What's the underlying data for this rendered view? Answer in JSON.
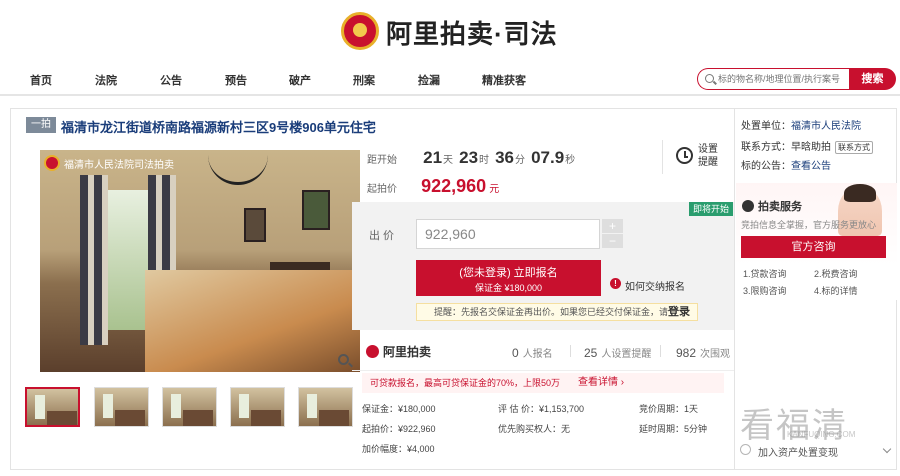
{
  "brand": {
    "name": "阿里拍卖·司法"
  },
  "nav": {
    "items": [
      {
        "label": "首页"
      },
      {
        "label": "法院"
      },
      {
        "label": "公告"
      },
      {
        "label": "预告"
      },
      {
        "label": "破产"
      },
      {
        "label": "刑案"
      },
      {
        "label": "捡漏"
      },
      {
        "label": "精准获客"
      }
    ],
    "search_placeholder": "标的物名称/地理位置/执行案号",
    "search_button": "搜索"
  },
  "lot": {
    "tag": "一拍",
    "title": "福清市龙江街道桥南路福源新村三区9号楼906单元住宅",
    "photo_watermark": "福清市人民法院司法拍卖",
    "countdown": {
      "label": "距开始",
      "days": "21",
      "days_unit": "天",
      "hours": "23",
      "hours_unit": "时",
      "minutes": "36",
      "minutes_unit": "分",
      "seconds": "07.9",
      "seconds_unit": "秒"
    },
    "reminder_label": "设置提醒",
    "start_price_label": "起拍价",
    "start_price": "922,960",
    "currency": "元",
    "status_badge": "即将开始",
    "bid_label": "出 价",
    "bid_value": "922,960",
    "step_plus": "+",
    "step_minus": "−",
    "register_line1": "(您未登录) 立即报名",
    "register_line2": "保证金 ¥180,000",
    "how_pay_link": "如何交纳报名",
    "notice_text": "提醒：先报名交保证金再出价。如果您已经交付保证金，请",
    "notice_login": "登录",
    "platform_name": "阿里拍卖",
    "stats": {
      "signup_count": "0",
      "signup_label": "人报名",
      "reminder_count": "25",
      "reminder_label": "人设置提醒",
      "view_count": "982",
      "view_label": "次围观"
    },
    "loan_notice": "可贷款报名，最高可贷保证金的70%，上限50万",
    "loan_link": "查看详情 ›",
    "info": {
      "deposit": "保证金：¥180,000",
      "appraisal": "评 估 价：¥1,153,700",
      "bid_period": "竞价周期：1天",
      "start_price": "起拍价：¥922,960",
      "priority_buyer": "优先购买权人：无",
      "delay_period": "延时周期：5分钟",
      "increment": "加价幅度：¥4,000"
    }
  },
  "side": {
    "unit_label": "处置单位：",
    "unit_value": "福清市人民法院",
    "contact_label": "联系方式：",
    "contact_value": "早晗助拍",
    "contact_tag": "联系方式",
    "notice_label": "标的公告：",
    "notice_link": "查看公告",
    "service_title": "拍卖服务",
    "service_sub": "竞拍信息全掌握，官方服务更放心",
    "service_button": "官方咨询",
    "service_items": [
      "1.贷款咨询",
      "2.税费咨询",
      "3.限购咨询",
      "4.标的详情"
    ],
    "watermark": "看福清",
    "watermark_url": "KANFUQING.COM",
    "bottom_note": "加入资产处置变现"
  },
  "colors": {
    "accent": "#c8102e",
    "link": "#1a3d7a",
    "badge_green": "#2a9d6e"
  }
}
